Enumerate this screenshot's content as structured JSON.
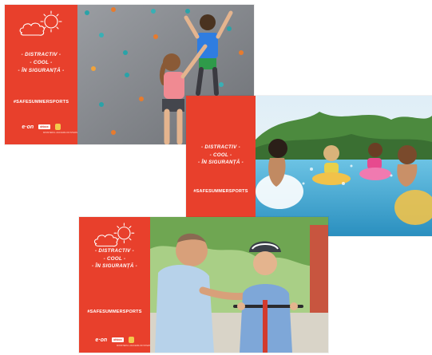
{
  "banners": [
    {
      "tagline": [
        "- DISTRACTIV -",
        "- COOL -",
        "- ÎN SIGURANȚĂ -"
      ],
      "hashtag": "#SAFESUMMERSPORTS",
      "logos": {
        "eon": "e·on",
        "partner": "ohbox",
        "sub": "MINISTERUL AFACERILOR INTERNE"
      },
      "photo": "children-climbing-wall"
    },
    {
      "tagline": [
        "- DISTRACTIV -",
        "- COOL -",
        "- ÎN SIGURANȚĂ -"
      ],
      "hashtag": "#SAFESUMMERSPORTS",
      "photo": "kids-in-swimming-pool"
    },
    {
      "tagline": [
        "- DISTRACTIV -",
        "- COOL -",
        "- ÎN SIGURANȚĂ -"
      ],
      "hashtag": "#SAFESUMMERSPORTS",
      "logos": {
        "eon": "e·on",
        "partner": "ohbox",
        "sub": "MINISTERUL AFACERILOR INTERNE"
      },
      "photo": "father-helping-child-with-bike-helmet"
    }
  ],
  "colors": {
    "brand_red": "#e8402c",
    "white": "#ffffff"
  }
}
